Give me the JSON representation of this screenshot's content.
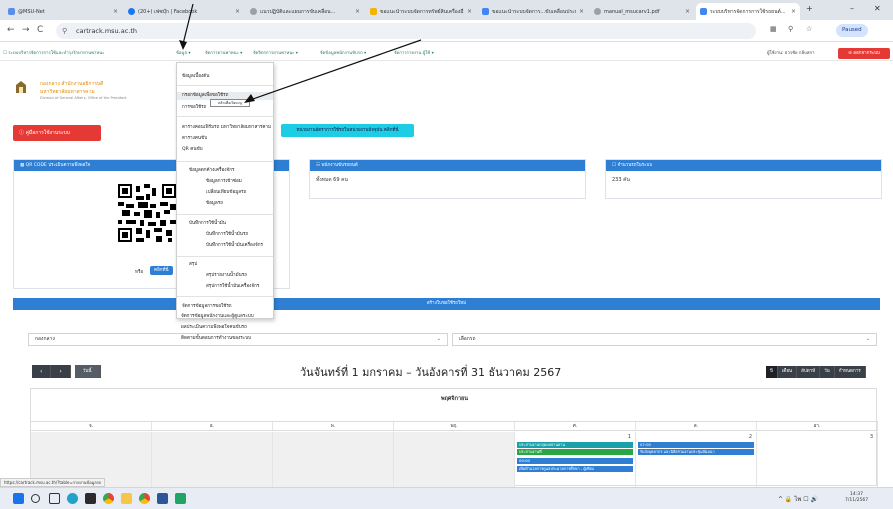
{
  "browser": {
    "tabs": [
      {
        "title": "@MSU-Net",
        "color": "#5b8def"
      },
      {
        "title": "(20+) เฟซบุ๊ก | Facebook",
        "color": "#1877f2"
      },
      {
        "title": "แนวปฏิบัติและแผนการขับเคลื่อน...",
        "color": "#5f6368"
      },
      {
        "title": "ขอแนะนำระบบจัดการทรัพย์สินเครื่องมือ...",
        "color": "#f4b400"
      },
      {
        "title": "ขอแนะนำระบบจัดการ...ขับเคลื่อนประมาณ",
        "color": "#4285f4"
      },
      {
        "title": "manual_msucarv1.pdf",
        "color": "#5f6368"
      },
      {
        "title": "ระบบบริหารจัดการการใช้รถยนต์...",
        "color": "#4285f4"
      }
    ],
    "url": "cartrack.msu.ac.th",
    "paused_label": "Paused",
    "new_tab": "+",
    "win_min": "–",
    "win_close": "✕"
  },
  "sitenav": {
    "brand": "☐ ระบบบริหารจัดการการใช้และบำรุงรักษายานพาหนะ",
    "items": [
      "ข้อมูล ▾",
      "จัดการยานพาหนะ ▾",
      "จัดจิตรการยานพาหนะ ▾",
      "จัดข้อมูลพนักงานขับรถ ▾",
      "จัดการรายงาน ผู้ใช้ ▾"
    ],
    "user": "ผู้ใช้งาน: ธวรชัย กลีบสกา",
    "logout": "⊖ ออกจากระบบ"
  },
  "header": {
    "org_line1": "กองกลาง สำนักงานอธิการบดี",
    "org_line2": "มหาวิทยาลัยมหาสารคาม",
    "org_line3": "Division of General Affairs, Office of the President"
  },
  "buttons": {
    "manual": "ⓘ คู่มือการใช้งานระบบ",
    "info": "หน่วยงานอัตราการใช้รถในหน่วยงานปัจจุบัน คลิกที่นี่",
    "qr_click": "คลิกที่นี่",
    "qr_prefix": "หรือ"
  },
  "cards": {
    "qr": {
      "title": "▦ QR CODE ประเมินความพึงพอใจ"
    },
    "drivers": {
      "title": "☷ พนักงานขับรถยนต์",
      "value": "ทั้งหมด 69 คน"
    },
    "cars": {
      "title": "☐ จำนวนรถในระบบ",
      "value": "233 คัน"
    }
  },
  "booking_bar": "สร้างใบขอใช้รถใหม่",
  "filters": {
    "division": "กองกลาง",
    "car": "เลือกรถ",
    "chev": "⌄"
  },
  "calendar": {
    "prev": "‹",
    "next": "›",
    "today": "วันนี้",
    "title": "วันจันทร์ที่ 1 มกราคม – วันอังคารที่ 31 ธันวาคม 2567",
    "views": [
      "ปี",
      "เดือน",
      "สัปดาห์",
      "วัน",
      "กำหนดการ"
    ],
    "month_label": "พฤศจิกายน",
    "dow": [
      "จ.",
      "อ.",
      "พ.",
      "พฤ.",
      "ศ.",
      "ส.",
      "อา."
    ],
    "day_numbers": [
      "1",
      "2",
      "3"
    ],
    "events": [
      {
        "text": "ประสานงานกลุ่มพลยานยาน",
        "color": "#19a0a8"
      },
      {
        "text": "ประสานงานที่",
        "color": "#28a745"
      },
      {
        "text": "09:00",
        "color": "#2e7fd4"
      },
      {
        "text": "เพื่อทำนวยการดูแลประมวลการศึกษา - ผู้เทียบ",
        "color": "#2e7fd4"
      },
      {
        "text": "07:00",
        "color": "#2e7fd4"
      },
      {
        "text": "รับส่งบุคลากร และนิสิตร่วมงานประชุมสัมมนา",
        "color": "#2e7fd4"
      }
    ]
  },
  "dropdown": {
    "items": [
      "ข้อมูลเบื้องต้น",
      "กรอกข้อมูลเพื่อขอใช้รถ",
      "การขอใช้รถ",
      "ตารางคอนเฟิร์มรถ มหาวิทยาลัยมหาสารคาม",
      "ตารางคนขับ",
      "QR คนขับ",
      "ข้อมูลตกค้างเครื่องจักร",
      "ข้อมูลการเข้าซ่อม",
      "เปลี่ยนเทียบข้อมูลรถ",
      "ข้อมูลรถ",
      "บันทึกการใช้น้ำมัน",
      "บันทึกการใช้น้ำมันรถ",
      "บันทึกการใช้น้ำมันเครื่องจักร",
      "สรุป",
      "สรุปรายงานน้ำมันรถ",
      "สรุปการใช้น้ำมันเครื่องจักร",
      "จัดการข้อมูลการขอใช้รถ",
      "จัดการข้อมูลพนักงานและผู้ดูแลระบบ",
      "ผลประเมินความพึงพอใจคนขับรถ",
      "ติดตามขั้นตอนการทำงานของระบบ"
    ],
    "tooltip": "คลิกเพื่อเปิดเมนู"
  },
  "status_url": "https://cartrack.msu.ac.th/?table=รายงานข้อมูลรถ",
  "taskbar": {
    "tray": "^ 🔒 ไพ ☐ 🔊",
    "time": "14:37",
    "date": "7/11/2567"
  }
}
